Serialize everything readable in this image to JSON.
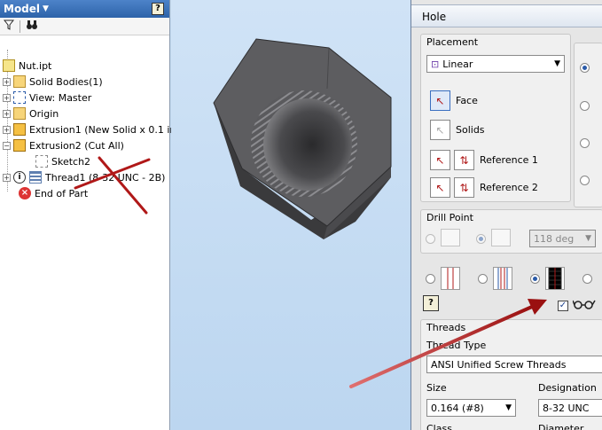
{
  "browser": {
    "title": "Model",
    "help_label": "?",
    "tree": [
      {
        "label": "Nut.ipt",
        "icon": "part-icon"
      },
      {
        "label": "Solid Bodies(1)",
        "icon": "folder-icon"
      },
      {
        "label": "View: Master",
        "icon": "view-icon"
      },
      {
        "label": "Origin",
        "icon": "folder-icon"
      },
      {
        "label": "Extrusion1 (New Solid x 0.1 in)",
        "icon": "extrusion-icon"
      },
      {
        "label": "Extrusion2 (Cut All)",
        "icon": "extrusion-icon"
      },
      {
        "label": "Sketch2",
        "icon": "sketch-icon"
      },
      {
        "label": "Thread1 (8-32 UNC - 2B)",
        "icon": "thread-icon"
      },
      {
        "label": "End of Part",
        "icon": "end-of-part-icon"
      }
    ]
  },
  "dialog": {
    "title": "Hole",
    "placement": {
      "label": "Placement",
      "type_value": "Linear",
      "face_label": "Face",
      "solids_label": "Solids",
      "reference1_label": "Reference 1",
      "reference2_label": "Reference 2"
    },
    "drill_point": {
      "label": "Drill Point",
      "angle_value": "118 deg"
    },
    "help_label": "?",
    "threads": {
      "label": "Threads",
      "thread_type_label": "Thread Type",
      "thread_type_value": "ANSI Unified Screw Threads",
      "size_label": "Size",
      "size_value": "0.164 (#8)",
      "designation_label": "Designation",
      "designation_value": "8-32 UNC",
      "class_label": "Class",
      "diameter_label": "Diameter"
    }
  },
  "colors": {
    "annotation_arrow": "#b01818",
    "canvas_background": "#c5dcf2",
    "nut_face": "#5d5d60"
  }
}
